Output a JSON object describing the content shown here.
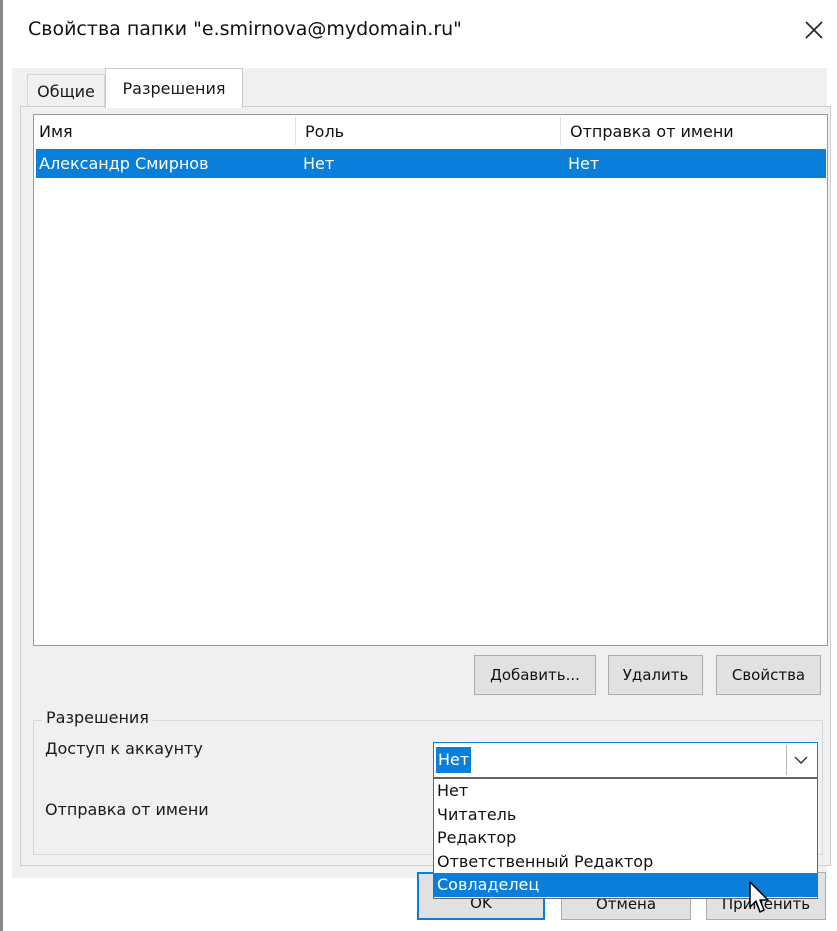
{
  "window": {
    "title": "Свойства папки \"e.smirnova@mydomain.ru\""
  },
  "tabs": [
    {
      "label": "Общие",
      "active": false
    },
    {
      "label": "Разрешения",
      "active": true
    }
  ],
  "table": {
    "columns": [
      "Имя",
      "Роль",
      "Отправка от имени"
    ],
    "rows": [
      {
        "name": "Александр Смирнов",
        "role": "Нет",
        "send_as": "Нет",
        "selected": true
      }
    ]
  },
  "buttons": {
    "add": "Добавить...",
    "remove": "Удалить",
    "properties": "Свойства",
    "ok": "OK",
    "cancel": "Отмена",
    "apply": "Применить"
  },
  "permissions": {
    "group_label": "Разрешения",
    "account_access_label": "Доступ к аккаунту",
    "send_as_label": "Отправка от имени",
    "selected_value": "Нет",
    "options": [
      "Нет",
      "Читатель",
      "Редактор",
      "Ответственный Редактор",
      "Совладелец"
    ],
    "highlighted_option_index": 4
  },
  "colors": {
    "selection": "#0a7fd9",
    "dialog_bg": "#f0f0f0",
    "button_bg": "#e1e1e1"
  },
  "icons": {
    "close": "close-icon",
    "dropdown": "chevron-down-icon",
    "cursor": "mouse-pointer-icon"
  }
}
